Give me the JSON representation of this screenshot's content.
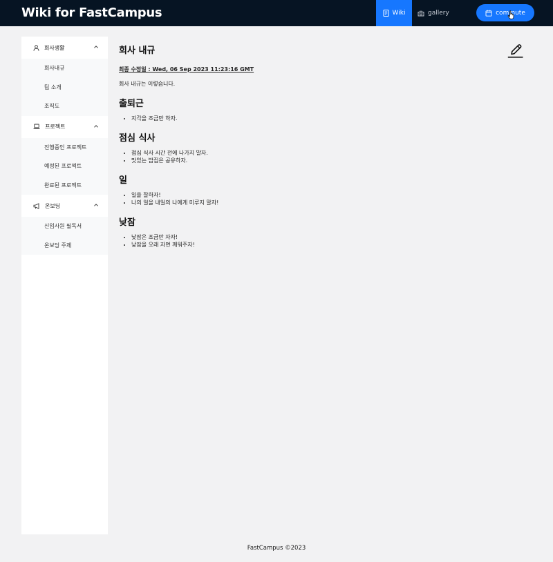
{
  "header": {
    "brand": "Wiki for FastCampus",
    "nav": [
      {
        "label": "Wiki",
        "icon": "document-icon"
      },
      {
        "label": "gallery",
        "icon": "camera-icon"
      }
    ],
    "commute_label": "commute",
    "colors": {
      "background": "#061423",
      "accent": "#1677ff"
    }
  },
  "sidebar": {
    "groups": [
      {
        "title": "회사생활",
        "icon": "user-icon",
        "items": [
          "회사내규",
          "팀 소개",
          "조직도"
        ]
      },
      {
        "title": "프로젝트",
        "icon": "laptop-icon",
        "items": [
          "진행중인 프로젝트",
          "예정된 프로젝트",
          "완료된 프로젝트"
        ]
      },
      {
        "title": "온보딩",
        "icon": "megaphone-icon",
        "items": [
          "신입사원 필독서",
          "온보딩 주제"
        ]
      }
    ]
  },
  "main": {
    "title": "회사 내규",
    "updated": "최종 수정일 : Wed, 06 Sep 2023 11:23:16 GMT",
    "intro": "회사 내규는 이렇습니다.",
    "sections": [
      {
        "title": "출퇴근",
        "items": [
          "지각을 조금만 하자."
        ]
      },
      {
        "title": "점심 식사",
        "items": [
          "점심 식사 시간 전에 나가지 말자.",
          "맛있는 밥집은 공유하자."
        ]
      },
      {
        "title": "일",
        "items": [
          "일을 잘하자!",
          "나의 일을 내일의 나에게 미루지 말자!"
        ]
      },
      {
        "title": "낮잠",
        "items": [
          "낮잠은 조금만 자자!",
          "낮잠을 오래 자면 깨워주자!"
        ]
      }
    ]
  },
  "footer": "FastCampus ©2023"
}
